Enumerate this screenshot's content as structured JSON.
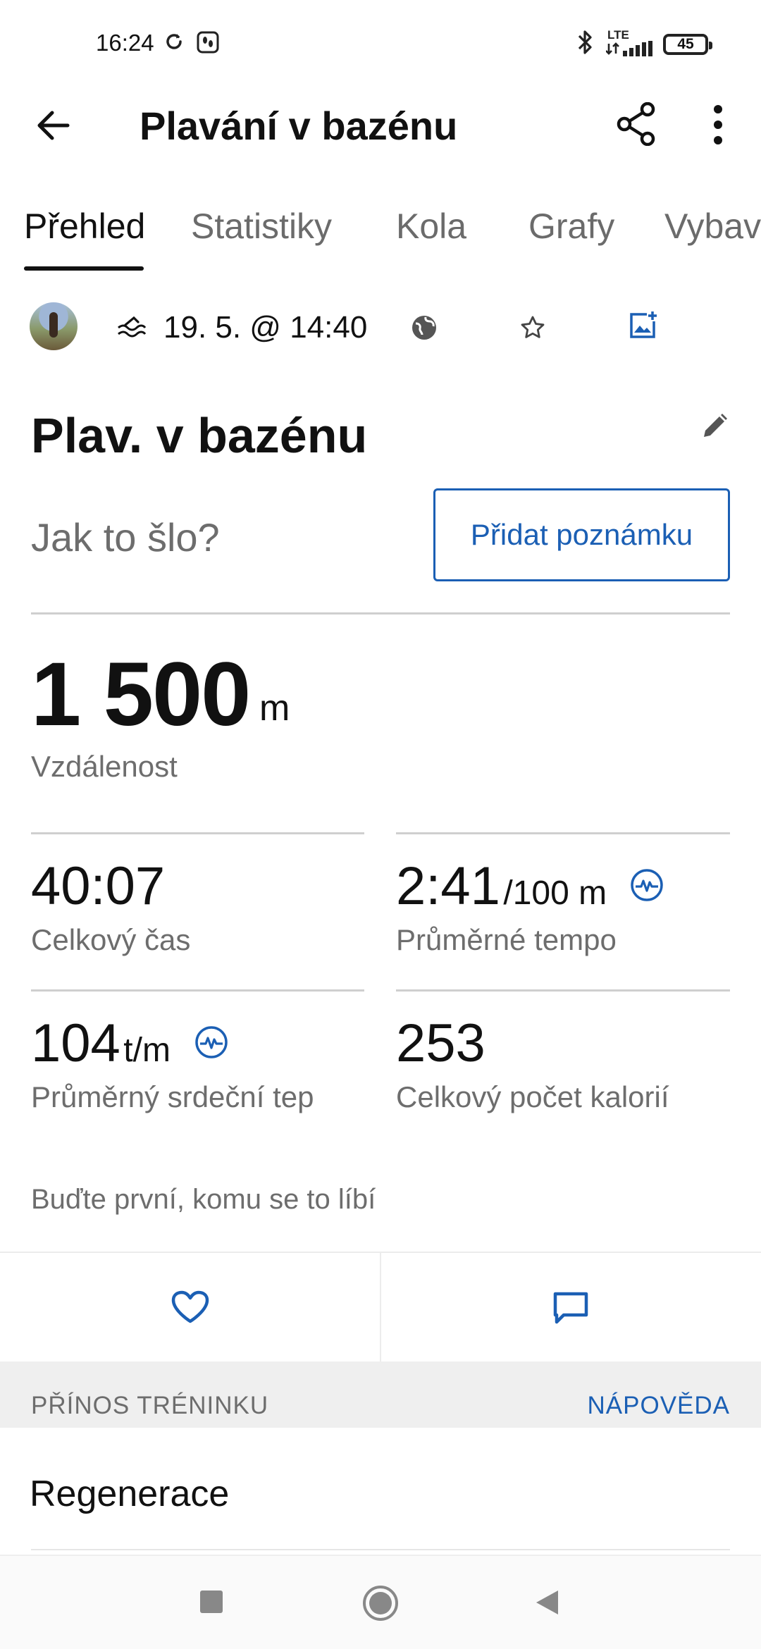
{
  "status_bar": {
    "time": "16:24",
    "network": "LTE",
    "battery": "45"
  },
  "app_bar": {
    "title": "Plavání v bazénu"
  },
  "tabs": [
    {
      "label": "Přehled",
      "active": true
    },
    {
      "label": "Statistiky",
      "active": false
    },
    {
      "label": "Kola",
      "active": false
    },
    {
      "label": "Grafy",
      "active": false
    },
    {
      "label": "Vybav",
      "active": false
    }
  ],
  "meta": {
    "date": "19. 5. @ 14:40"
  },
  "activity": {
    "name": "Plav. v bazénu"
  },
  "note": {
    "prompt": "Jak to šlo?",
    "button_label": "Přidat poznámku"
  },
  "distance": {
    "value": "1 500",
    "unit": "m",
    "label": "Vzdálenost"
  },
  "stats": [
    {
      "value": "40:07",
      "unit": "",
      "label": "Celkový čas"
    },
    {
      "value": "2:41",
      "unit": "/100 m",
      "label": "Průměrné tempo"
    },
    {
      "value": "104",
      "unit": "t/m",
      "label": "Průměrný srdeční tep"
    },
    {
      "value": "253",
      "unit": "",
      "label": "Celkový počet kalorií"
    }
  ],
  "social": {
    "likes_text": "Buďte první, komu se to líbí"
  },
  "training_effect": {
    "section_title": "PŘÍNOS TRÉNINKU",
    "help_label": "NÁPOVĚDA",
    "value": "Regenerace"
  },
  "colors": {
    "accent": "#1b5fb4",
    "text_primary": "#111111",
    "text_secondary": "#6d6d6d",
    "section_bg": "#efefef"
  }
}
